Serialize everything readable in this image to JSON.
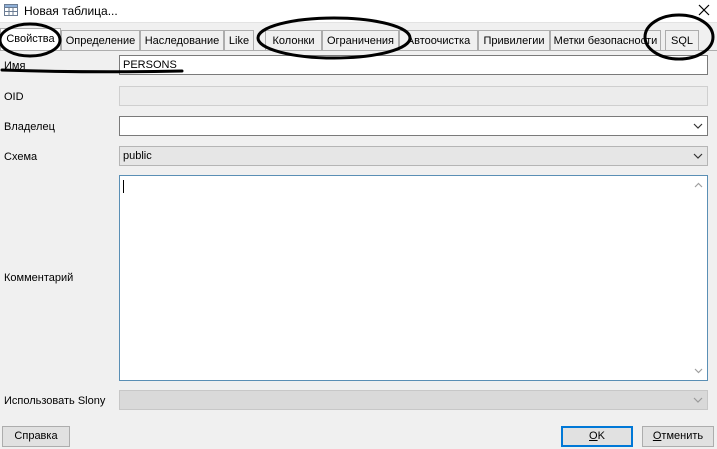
{
  "window": {
    "title": "Новая таблица...",
    "app_icon": "table-icon",
    "close_icon": "close-icon"
  },
  "tabs": [
    {
      "label": "Свойства",
      "active": true
    },
    {
      "label": "Определение"
    },
    {
      "label": "Наследование"
    },
    {
      "label": "Like"
    },
    {
      "label": "Колонки"
    },
    {
      "label": "Ограничения"
    },
    {
      "label": "Автоочистка"
    },
    {
      "label": "Привилегии"
    },
    {
      "label": "Метки безопасности"
    },
    {
      "label": "SQL"
    }
  ],
  "form": {
    "name_label": "Имя",
    "name_value": "PERSONS",
    "oid_label": "OID",
    "oid_value": "",
    "owner_label": "Владелец",
    "owner_value": "",
    "schema_label": "Схема",
    "schema_value": "public",
    "comment_label": "Комментарий",
    "comment_value": "",
    "slony_label": "Использовать Slony",
    "slony_value": ""
  },
  "buttons": {
    "help": "Справка",
    "ok_mnemonic": "O",
    "ok_rest": "K",
    "cancel_mnemonic": "О",
    "cancel_rest": "тменить"
  },
  "colors": {
    "dialog_bg": "#f0f0f0",
    "focus_border": "#0078d7",
    "annotation_ink": "#000000"
  }
}
